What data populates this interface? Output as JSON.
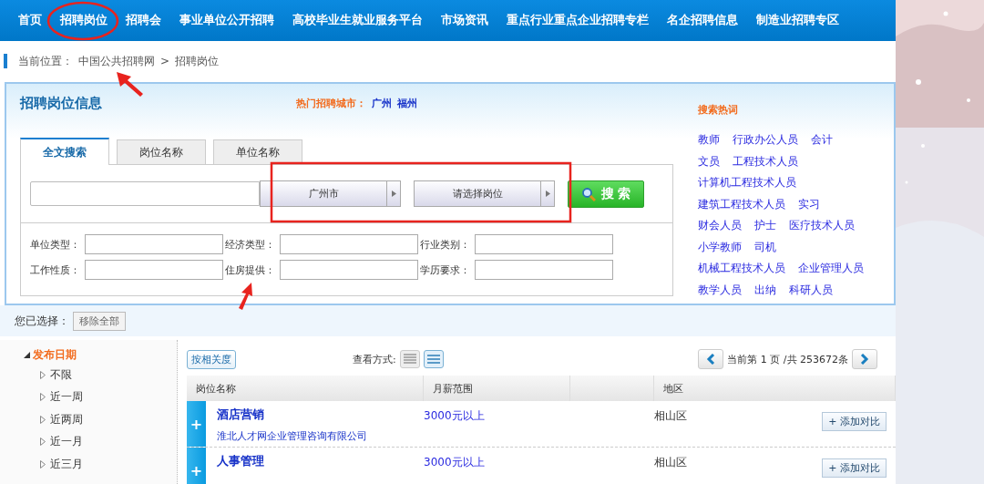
{
  "nav": [
    {
      "label": "首页"
    },
    {
      "label": "招聘岗位"
    },
    {
      "label": "招聘会"
    },
    {
      "label": "事业单位公开招聘"
    },
    {
      "label": "高校毕业生就业服务平台"
    },
    {
      "label": "市场资讯"
    },
    {
      "label": "重点行业重点企业招聘专栏"
    },
    {
      "label": "名企招聘信息"
    },
    {
      "label": "制造业招聘专区"
    }
  ],
  "breadcrumb": {
    "label": "当前位置：",
    "items": [
      "中国公共招聘网",
      "招聘岗位"
    ],
    "separator": ">"
  },
  "search_panel": {
    "title": "招聘岗位信息",
    "hot_cities_label": "热门招聘城市：",
    "hot_cities": [
      "广州",
      "福州"
    ],
    "tabs": [
      {
        "label": "全文搜索",
        "selected": true
      },
      {
        "label": "岗位名称",
        "selected": false
      },
      {
        "label": "单位名称",
        "selected": false
      }
    ],
    "city_select": "广州市",
    "job_select": "请选择岗位",
    "search_button": "搜 索",
    "filters": [
      {
        "label": "单位类型："
      },
      {
        "label": "经济类型："
      },
      {
        "label": "行业类别："
      },
      {
        "label": "工作性质："
      },
      {
        "label": "住房提供："
      },
      {
        "label": "学历要求："
      }
    ],
    "hot_keywords_title": "搜索热词",
    "hot_keywords": [
      [
        "教师",
        "行政办公人员",
        "会计"
      ],
      [
        "文员",
        "工程技术人员"
      ],
      [
        "计算机工程技术人员"
      ],
      [
        "建筑工程技术人员",
        "实习"
      ],
      [
        "财会人员",
        "护士",
        "医疗技术人员"
      ],
      [
        "小学教师",
        "司机"
      ],
      [
        "机械工程技术人员",
        "企业管理人员"
      ],
      [
        "教学人员",
        "出纳",
        "科研人员"
      ]
    ]
  },
  "selected_bar": {
    "label": "您已选择：",
    "button": "移除全部"
  },
  "sidebar": {
    "items": [
      {
        "label": "发布日期",
        "expanded": true,
        "children": [
          {
            "label": "不限"
          },
          {
            "label": "近一周"
          },
          {
            "label": "近两周"
          },
          {
            "label": "近一月"
          },
          {
            "label": "近三月"
          }
        ]
      }
    ]
  },
  "toolbar": {
    "sort_button": "按相关度",
    "view_label": "查看方式:",
    "view_modes": [
      {
        "selected": false
      },
      {
        "selected": true
      }
    ],
    "pagination": "当前第 1 页 /共 253672条"
  },
  "table": {
    "columns": [
      "岗位名称",
      "月薪范围",
      "地区"
    ],
    "rows": [
      {
        "toggle": "+",
        "title": "酒店营销",
        "company": "淮北人才网企业管理咨询有限公司",
        "salary": "3000元以上",
        "district": "相山区",
        "button": "+ 添加对比"
      },
      {
        "toggle": "+",
        "title": "人事管理",
        "salary": "3000元以上",
        "district": "相山区",
        "button": "+ 添加对比"
      }
    ]
  },
  "annotations": [
    {
      "kind": "ellipse"
    },
    {
      "kind": "arrow"
    },
    {
      "kind": "rectangle"
    },
    {
      "kind": "arrow"
    }
  ]
}
